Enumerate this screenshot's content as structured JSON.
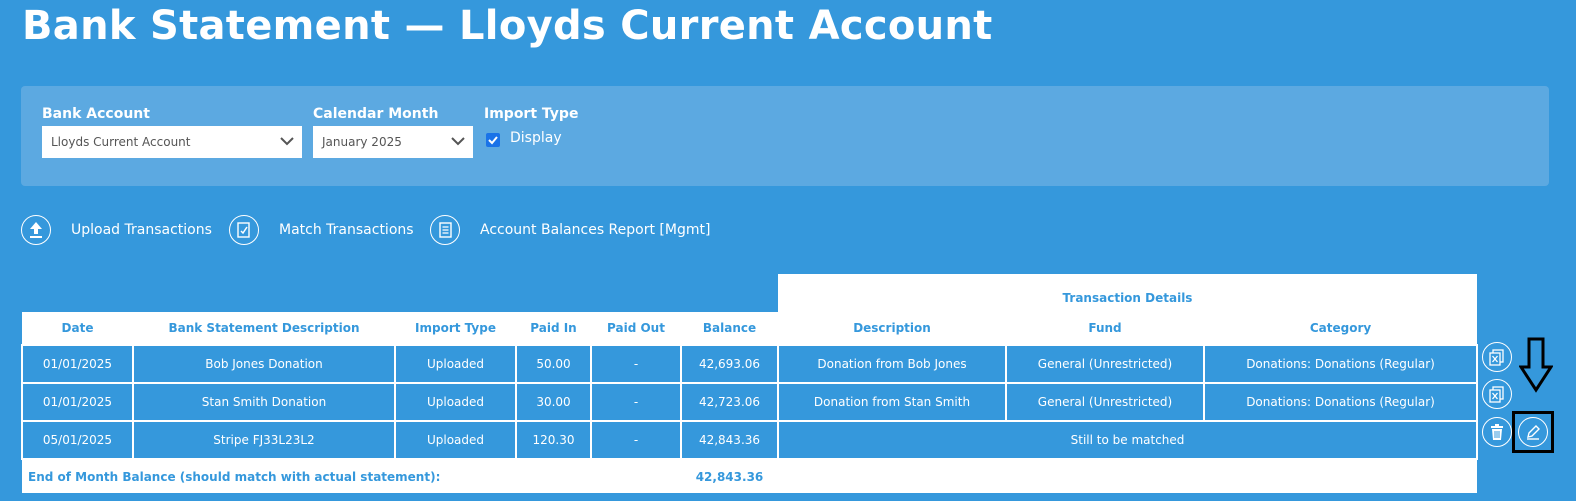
{
  "page": {
    "title": "Bank Statement — Lloyds Current Account"
  },
  "filters": {
    "bank_account": {
      "label": "Bank Account",
      "value": "Lloyds Current Account"
    },
    "calendar_month": {
      "label": "Calendar Month",
      "value": "January 2025"
    },
    "import_type": {
      "label": "Import Type",
      "option_label": "Display",
      "checked": true
    }
  },
  "actions": {
    "upload": "Upload Transactions",
    "match": "Match Transactions",
    "report": "Account Balances Report [Mgmt]"
  },
  "table": {
    "group_header": "Transaction Details",
    "columns": {
      "date": "Date",
      "bank_desc": "Bank Statement Description",
      "import_type": "Import Type",
      "paid_in": "Paid In",
      "paid_out": "Paid Out",
      "balance": "Balance",
      "description": "Description",
      "fund": "Fund",
      "category": "Category"
    },
    "rows": [
      {
        "date": "01/01/2025",
        "bank_desc": "Bob Jones Donation",
        "import_type": "Uploaded",
        "paid_in": "50.00",
        "paid_out": "-",
        "balance": "42,693.06",
        "description": "Donation from Bob Jones",
        "fund": "General (Unrestricted)",
        "category": "Donations: Donations (Regular)"
      },
      {
        "date": "01/01/2025",
        "bank_desc": "Stan Smith Donation",
        "import_type": "Uploaded",
        "paid_in": "30.00",
        "paid_out": "-",
        "balance": "42,723.06",
        "description": "Donation from Stan Smith",
        "fund": "General (Unrestricted)",
        "category": "Donations: Donations (Regular)"
      },
      {
        "date": "05/01/2025",
        "bank_desc": "Stripe FJ33L23L2",
        "import_type": "Uploaded",
        "paid_in": "120.30",
        "paid_out": "-",
        "balance": "42,843.36",
        "status": "Still to be matched"
      }
    ],
    "footer": {
      "label": "End of Month Balance (should match with actual statement):",
      "balance": "42,843.36"
    }
  },
  "colors": {
    "background": "#3598dc",
    "panel": "#5ca9e1",
    "checkbox": "#1a73e8"
  }
}
